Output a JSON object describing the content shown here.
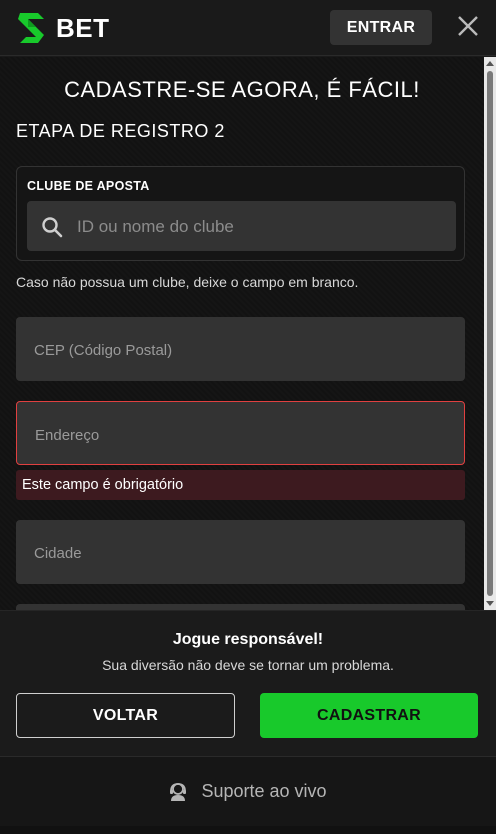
{
  "header": {
    "logo_text": "BET",
    "login_label": "ENTRAR",
    "brand_color": "#18c92b"
  },
  "form": {
    "title": "CADASTRE-SE AGORA, É FÁCIL!",
    "step": "ETAPA DE REGISTRO 2",
    "club": {
      "label": "CLUBE DE APOSTA",
      "placeholder": "ID ou nome do clube",
      "hint": "Caso não possua um clube, deixe o campo em branco."
    },
    "fields": {
      "cep": "CEP (Código Postal)",
      "endereco": "Endereço",
      "endereco_error": "Este campo é obrigatório",
      "cidade": "Cidade"
    }
  },
  "footer": {
    "resp_title": "Jogue responsável!",
    "resp_sub": "Sua diversão não deve se tornar um problema.",
    "back_label": "VOLTAR",
    "submit_label": "CADASTRAR",
    "support_label": "Suporte ao vivo"
  },
  "icons": {
    "logo": "logo-icon",
    "close": "close-icon",
    "search": "search-icon",
    "support": "support-agent-icon"
  }
}
